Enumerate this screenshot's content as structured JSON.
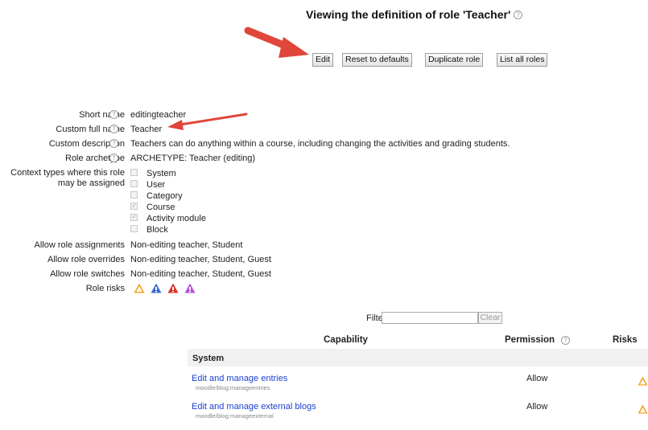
{
  "header": {
    "title": "Viewing the definition of role 'Teacher'",
    "buttons": {
      "edit": "Edit",
      "reset": "Reset to defaults",
      "duplicate": "Duplicate role",
      "list_all": "List all roles"
    }
  },
  "fields": {
    "short_name": {
      "label": "Short name",
      "value": "editingteacher"
    },
    "full_name": {
      "label": "Custom full name",
      "value": "Teacher"
    },
    "description": {
      "label": "Custom description",
      "value": "Teachers can do anything within a course, including changing the activities and grading students."
    },
    "archetype": {
      "label": "Role archetype",
      "value": "ARCHETYPE: Teacher (editing)"
    },
    "context": {
      "label_line1": "Context types where this role",
      "label_line2": "may be assigned",
      "options": [
        {
          "label": "System",
          "checked": false
        },
        {
          "label": "User",
          "checked": false
        },
        {
          "label": "Category",
          "checked": false
        },
        {
          "label": "Course",
          "checked": true
        },
        {
          "label": "Activity module",
          "checked": true
        },
        {
          "label": "Block",
          "checked": false
        }
      ]
    },
    "assignments": {
      "label": "Allow role assignments",
      "value": "Non-editing teacher, Student"
    },
    "overrides": {
      "label": "Allow role overrides",
      "value": "Non-editing teacher, Student, Guest"
    },
    "switches": {
      "label": "Allow role switches",
      "value": "Non-editing teacher, Student, Guest"
    },
    "risks": {
      "label": "Role risks",
      "icons": [
        "config-risk",
        "personal-risk",
        "xss-risk",
        "dataloss-risk"
      ]
    }
  },
  "table": {
    "filter_label": "Filter",
    "filter_value": "",
    "clear_label": "Clear",
    "headers": {
      "capability": "Capability",
      "permission": "Permission",
      "risks": "Risks"
    },
    "section": "System",
    "rows": [
      {
        "name": "Edit and manage entries",
        "code": "moodle/blog:manageentries",
        "permission": "Allow"
      },
      {
        "name": "Edit and manage external blogs",
        "code": "moodle/blog:manageexternal",
        "permission": "Allow"
      }
    ]
  },
  "colors": {
    "annotation_arrow": "#e0463a",
    "link": "#1a3fd6",
    "risk_orange": "#f5a623",
    "risk_blue": "#3a6fd8",
    "risk_red": "#d9342b",
    "risk_purple": "#b456d9"
  }
}
